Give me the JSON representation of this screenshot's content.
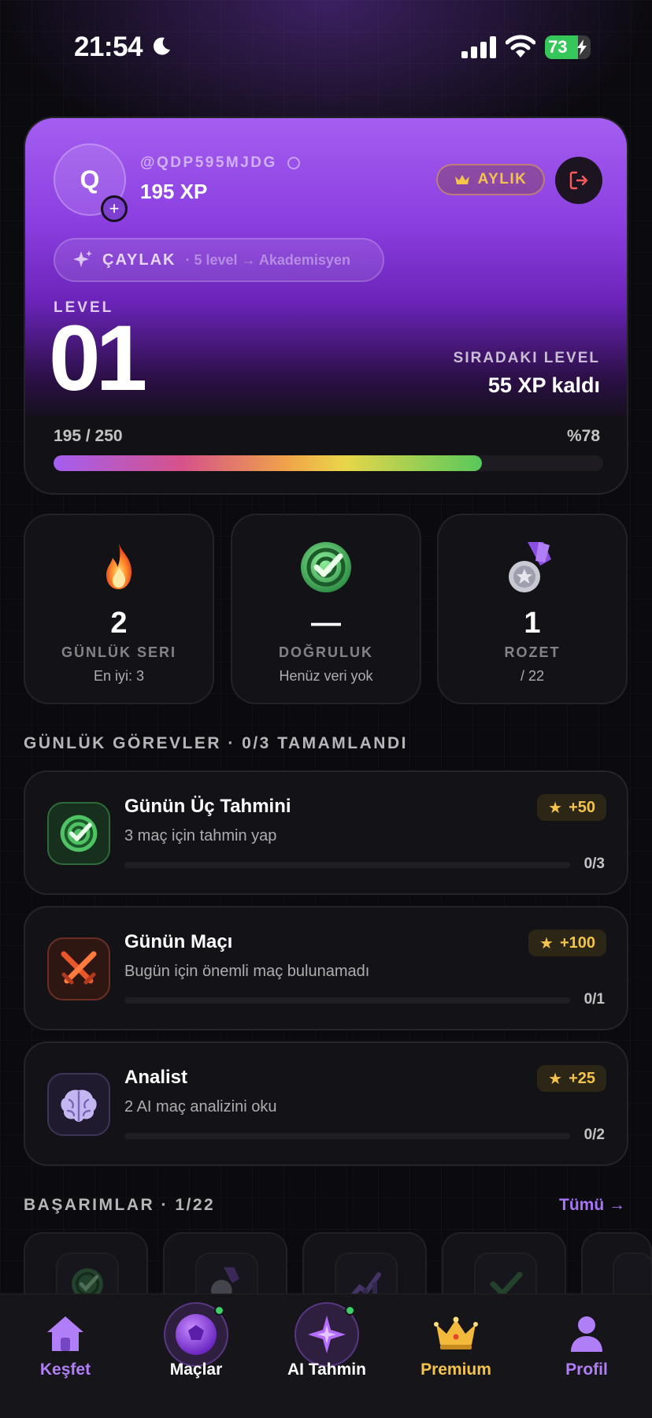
{
  "status_bar": {
    "time": "21:54",
    "battery": "73",
    "battery_level": 0.73,
    "icons": [
      "moon-icon",
      "signal-icon",
      "wifi-icon",
      "battery-charging-icon"
    ]
  },
  "profile": {
    "avatar_initial": "Q",
    "username": "@QDP595MJDG",
    "xp_total": "195 XP",
    "plan_badge": "AYLIK",
    "rank_title": "ÇAYLAK",
    "rank_sub": "· 5 level → Akademisyen",
    "level_label": "LEVEL",
    "level_number": "01",
    "next_level_label": "SIRADAKI LEVEL",
    "next_level_value": "55 XP kaldı",
    "progress_text": "195 / 250",
    "progress_percent_text": "%78",
    "progress_fraction": 0.78
  },
  "stats": [
    {
      "value": "2",
      "label": "GÜNLÜK SERI",
      "sub": "En iyi: 3",
      "icon": "fire-icon"
    },
    {
      "value": "—",
      "label": "DOĞRULUK",
      "sub": "Henüz veri yok",
      "icon": "target-icon"
    },
    {
      "value": "1",
      "label": "ROZET",
      "sub": "/ 22",
      "icon": "medal-icon"
    }
  ],
  "daily_tasks": {
    "header": "GÜNLÜK GÖREVLER · 0/3 TAMAMLANDI",
    "items": [
      {
        "title": "Günün Üç Tahmini",
        "desc": "3 maç için tahmin yap",
        "reward": "+50",
        "count": "0/3",
        "progress": 0,
        "icon": "target-icon"
      },
      {
        "title": "Günün Maçı",
        "desc": "Bugün için önemli maç bulunamadı",
        "reward": "+100",
        "count": "0/1",
        "progress": 0,
        "icon": "crossed-swords-icon"
      },
      {
        "title": "Analist",
        "desc": "2 AI maç analizini oku",
        "reward": "+25",
        "count": "0/2",
        "progress": 0,
        "icon": "brain-icon"
      }
    ]
  },
  "achievements": {
    "header": "BAŞARIMLAR · 1/22",
    "see_all": "Tümü →"
  },
  "bottom_nav": {
    "items": [
      {
        "label": "Keşfet",
        "icon": "home-icon",
        "color": "#b07ef7"
      },
      {
        "label": "Maçlar",
        "icon": "ball-icon",
        "color": "#ffffff"
      },
      {
        "label": "AI Tahmin",
        "icon": "sparkle-icon",
        "color": "#ffffff"
      },
      {
        "label": "Premium",
        "icon": "crown-icon",
        "color": "#f3c34b"
      },
      {
        "label": "Profil",
        "icon": "user-icon",
        "color": "#b07ef7"
      }
    ]
  },
  "colors": {
    "accent": "#a45ef0",
    "gold": "#f3c34b",
    "green": "#35c759",
    "background": "#0b0a0e"
  }
}
